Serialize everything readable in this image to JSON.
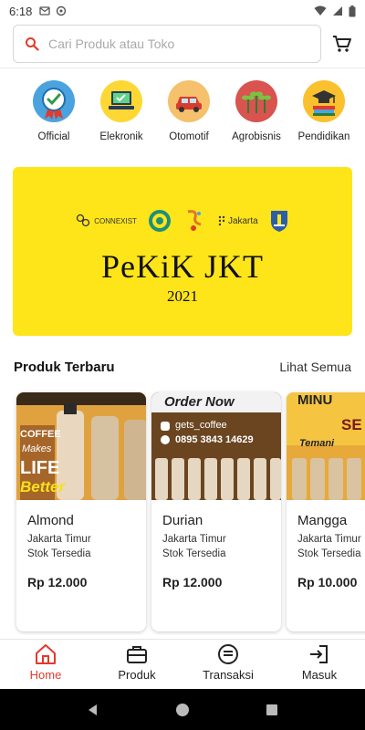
{
  "status_bar": {
    "time": "6:18"
  },
  "search": {
    "placeholder": "Cari Produk atau Toko"
  },
  "categories": [
    {
      "label": "Official",
      "icon": "verified-badge-icon",
      "color": "#4aa3df"
    },
    {
      "label": "Elekronik",
      "icon": "laptop-icon",
      "color": "#fdd835"
    },
    {
      "label": "Otomotif",
      "icon": "car-icon",
      "color": "#f5c16c"
    },
    {
      "label": "Agrobisnis",
      "icon": "sprout-icon",
      "color": "#d9534f"
    },
    {
      "label": "Pendidikan",
      "icon": "graduation-cap-icon",
      "color": "#fbc02d"
    }
  ],
  "banner": {
    "title": "PeKiK JKT",
    "year": "2021",
    "logo_connexist": "CONNEXIST",
    "logo_jakarta": "Jakarta",
    "background": "#fde51a"
  },
  "section": {
    "title": "Produk Terbaru",
    "see_all": "Lihat Semua"
  },
  "products": [
    {
      "name": "Almond",
      "location": "Jakarta Timur",
      "stock": "Stok Tersedia",
      "price": "Rp 12.000",
      "img_text_1": "COFFEE",
      "img_text_2": "Makes",
      "img_text_3": "LIFE",
      "img_text_4": "Better"
    },
    {
      "name": "Durian",
      "location": "Jakarta Timur",
      "stock": "Stok Tersedia",
      "price": "Rp 12.000",
      "img_text_1": "Order Now",
      "img_text_2": "gets_coffee",
      "img_text_3": "0895 3843 14629"
    },
    {
      "name": "Mangga",
      "location": "Jakarta Timur",
      "stock": "Stok Tersedia",
      "price": "Rp 10.000",
      "img_text_1": "MINU",
      "img_text_2": "SE",
      "img_text_3": "Temani"
    }
  ],
  "bottom_nav": [
    {
      "label": "Home",
      "icon": "home-icon",
      "active": true
    },
    {
      "label": "Produk",
      "icon": "briefcase-icon",
      "active": false
    },
    {
      "label": "Transaksi",
      "icon": "transaction-icon",
      "active": false
    },
    {
      "label": "Masuk",
      "icon": "login-icon",
      "active": false
    }
  ],
  "colors": {
    "accent": "#e23a2c",
    "banner": "#fde51a"
  }
}
